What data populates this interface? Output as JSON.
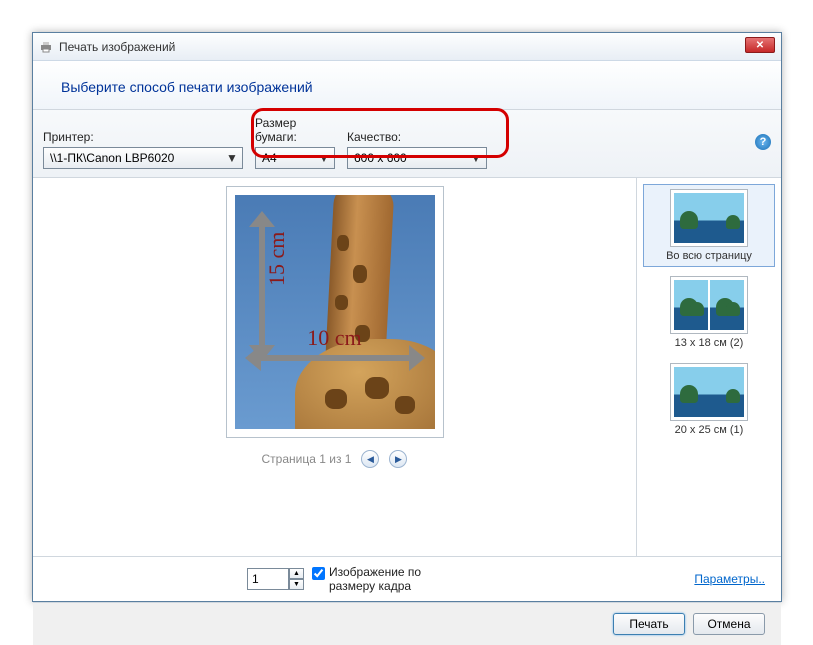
{
  "title": "Печать изображений",
  "header": "Выберите способ печати изображений",
  "toolbar": {
    "printer_label": "Принтер:",
    "printer_value": "\\\\1-ПК\\Canon LBP6020",
    "paper_label": "Размер бумаги:",
    "paper_value": "A4",
    "quality_label": "Качество:",
    "quality_value": "600 x 600"
  },
  "preview": {
    "width_label": "10 cm",
    "height_label": "15 cm",
    "pager": "Страница 1 из 1"
  },
  "layouts": {
    "full": "Во всю страницу",
    "l13x18": "13 x 18 см (2)",
    "l20x25": "20 x 25 см (1)"
  },
  "bottom": {
    "copies": "1",
    "fit_label": "Изображение по размеру кадра",
    "params": "Параметры.."
  },
  "footer": {
    "print": "Печать",
    "cancel": "Отмена"
  }
}
